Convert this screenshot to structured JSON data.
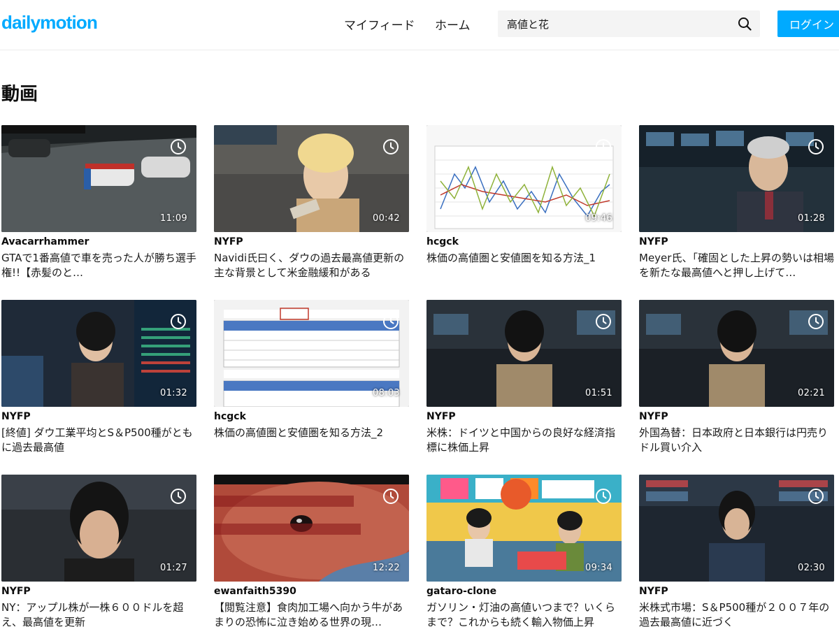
{
  "header": {
    "logo": "dailymotion",
    "nav": [
      "マイフィード",
      "ホーム"
    ],
    "search": {
      "value": "高値と花",
      "icon": "search-icon"
    },
    "login_label": "ログイン",
    "brand_color": "#00aaff"
  },
  "section": {
    "title": "動画"
  },
  "videos": [
    {
      "channel": "Avacarrhammer",
      "title": "GTAで1番高値で車を売った人が勝ち選手権!!【赤髪のと…",
      "duration": "11:09",
      "scene": "road"
    },
    {
      "channel": "NYFP",
      "title": "Navidi氏曰く、ダウの過去最高値更新の主な背景として米金融緩和がある",
      "duration": "00:42",
      "scene": "interview"
    },
    {
      "channel": "hcgck",
      "title": "株価の高値圏と安値圏を知る方法_1",
      "duration": "09:46",
      "scene": "chart"
    },
    {
      "channel": "NYFP",
      "title": "Meyer氏、「確固とした上昇の勢いは相場を新たな最高値へと押し上げて…",
      "duration": "01:28",
      "scene": "floor"
    },
    {
      "channel": "NYFP",
      "title": "[終値] ダウ工業平均とS＆P500種がともに過去最高値",
      "duration": "01:32",
      "scene": "reporter-blue"
    },
    {
      "channel": "hcgck",
      "title": "株価の高値圏と安値圏を知る方法_2",
      "duration": "08:03",
      "scene": "table"
    },
    {
      "channel": "NYFP",
      "title": "米株：ドイツと中国からの良好な経済指標に株価上昇",
      "duration": "01:51",
      "scene": "reporter-dark"
    },
    {
      "channel": "NYFP",
      "title": "外国為替：日本政府と日本銀行は円売りドル買い介入",
      "duration": "02:21",
      "scene": "reporter-dark"
    },
    {
      "channel": "NYFP",
      "title": "NY：アップル株が一株６００ドルを超え、最高値を更新",
      "duration": "01:27",
      "scene": "reporter-close"
    },
    {
      "channel": "ewanfaith5390",
      "title": "【閲覧注意】食肉加工場へ向かう牛があまりの恐怖に泣き始める世界の現…",
      "duration": "12:22",
      "scene": "cow"
    },
    {
      "channel": "gataro-clone",
      "title": "ガソリン・灯油の高値いつまで？いくらまで？これからも続く輸入物価上昇",
      "duration": "09:34",
      "scene": "tv-studio"
    },
    {
      "channel": "NYFP",
      "title": "米株式市場：S＆P500種が２００７年の過去最高値に近づく",
      "duration": "02:30",
      "scene": "floor-reporter"
    }
  ]
}
